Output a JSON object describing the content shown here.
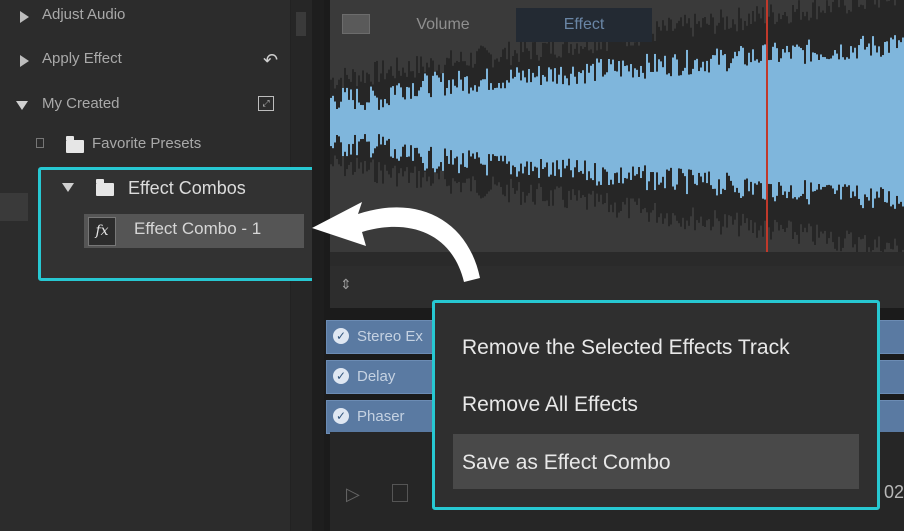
{
  "left_panel": {
    "items": [
      {
        "label": "Adjust Audio"
      },
      {
        "label": "Apply Effect"
      },
      {
        "label": "My Created"
      },
      {
        "label": "Favorite Presets"
      }
    ],
    "effect_combos": {
      "label": "Effect Combos"
    },
    "effect_combo_item": {
      "label": "Effect Combo - 1",
      "icon_text": "fx"
    }
  },
  "tabs": [
    {
      "label": "Volume"
    },
    {
      "label": "Effect"
    }
  ],
  "effect_tracks": [
    {
      "label": "Stereo Ex"
    },
    {
      "label": "Delay"
    },
    {
      "label": "Phaser"
    }
  ],
  "context_menu": {
    "items": [
      {
        "label": "Remove the Selected Effects Track"
      },
      {
        "label": "Remove All Effects"
      },
      {
        "label": "Save as Effect Combo"
      }
    ]
  },
  "timecode_fragment": "02",
  "colors": {
    "highlight": "#27c8d2",
    "waveform": "#7fb6dc",
    "playhead": "#c0392b"
  },
  "icons": [
    "triangle-right-icon",
    "triangle-down-icon",
    "folder-icon",
    "undo-icon",
    "expand-icon",
    "fx-icon",
    "check-icon",
    "play-icon",
    "stop-icon",
    "sort-icon",
    "curved-arrow-icon"
  ]
}
